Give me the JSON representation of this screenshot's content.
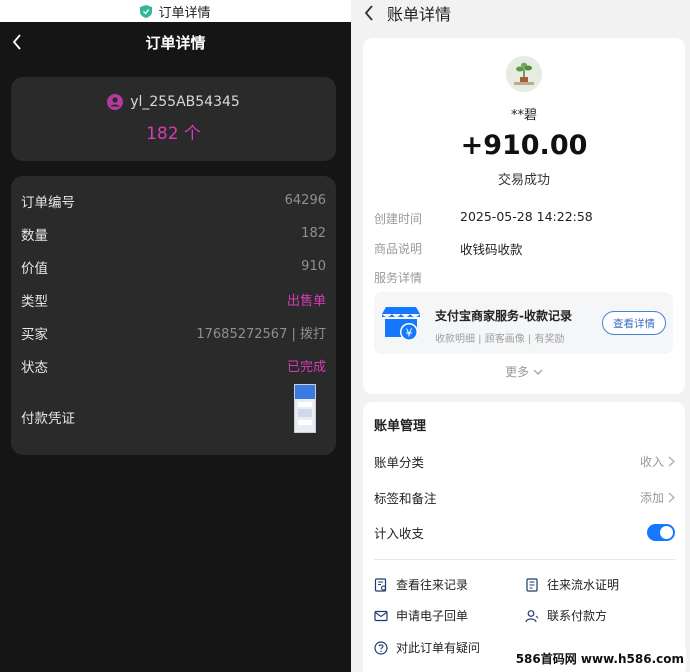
{
  "left": {
    "status_bar_title": "订单详情",
    "nav_title": "订单详情",
    "user": {
      "name": "yl_255AB54345",
      "quantity": "182 个"
    },
    "details": [
      {
        "key": "订单编号",
        "value": "64296"
      },
      {
        "key": "数量",
        "value": "182"
      },
      {
        "key": "价值",
        "value": "910"
      },
      {
        "key": "类型",
        "value": "出售单"
      },
      {
        "key": "买家",
        "value": "17685272567 | 拨打"
      },
      {
        "key": "状态",
        "value": "已完成"
      }
    ],
    "proof_label": "付款凭证",
    "accent_color": "#d63bb5"
  },
  "right": {
    "nav_title": "账单详情",
    "payer_name": "**碧",
    "amount": "+910.00",
    "status": "交易成功",
    "info": [
      {
        "key": "创建时间",
        "value": "2025-05-28 14:22:58"
      },
      {
        "key": "商品说明",
        "value": "收钱码收款"
      },
      {
        "key": "服务详情",
        "value": ""
      }
    ],
    "promo": {
      "title": "支付宝商家服务-收款记录",
      "subtitle": "收款明细 | 顾客画像 | 有奖励",
      "button": "查看详情"
    },
    "more": "更多",
    "management": {
      "title": "账单管理",
      "category_label": "账单分类",
      "category_value": "收入",
      "tag_label": "标签和备注",
      "tag_value": "添加",
      "count_label": "计入收支",
      "count_on": true
    },
    "links": {
      "history": "查看往来记录",
      "proof": "往来流水证明",
      "receipt": "申请电子回单",
      "contact": "联系付款方",
      "question": "对此订单有疑问"
    },
    "toggle_color": "#1677ff"
  },
  "watermark": "586首码网 www.h586.com"
}
